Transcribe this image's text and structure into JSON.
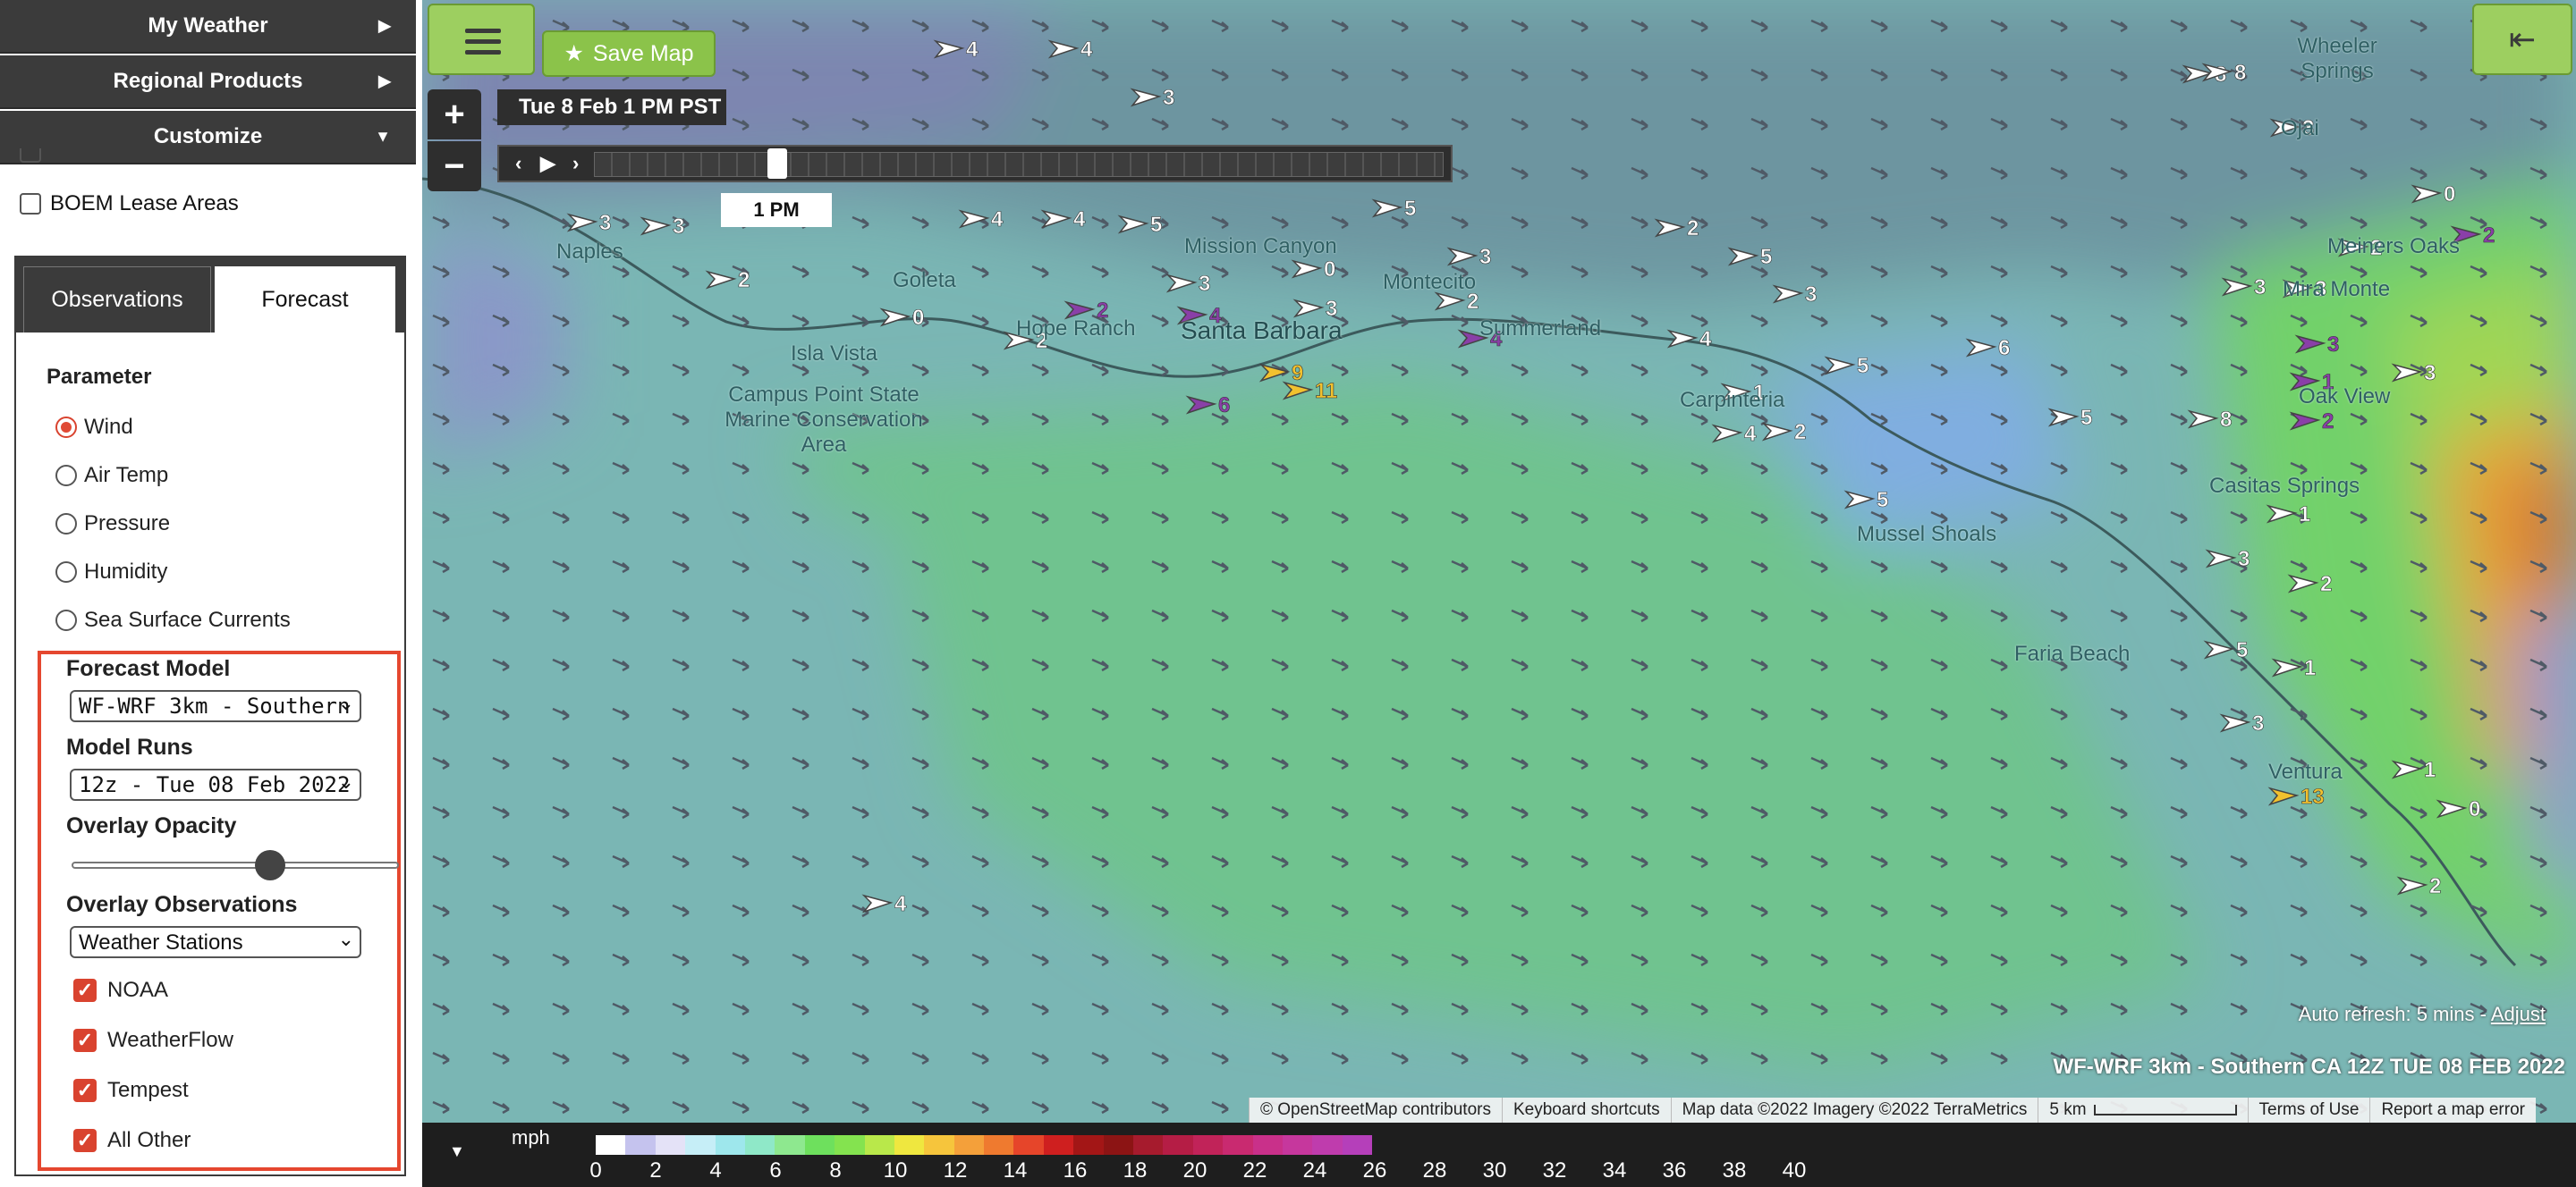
{
  "sidebar": {
    "headers": {
      "my_weather": "My Weather",
      "regional_products": "Regional Products",
      "customize": "Customize"
    },
    "layers": {
      "boem_lease_areas": "BOEM Lease Areas"
    },
    "tabs": {
      "observations": "Observations",
      "forecast": "Forecast"
    },
    "parameter": {
      "title": "Parameter",
      "options": [
        "Wind",
        "Air Temp",
        "Pressure",
        "Humidity",
        "Sea Surface Currents"
      ],
      "selected": "Wind"
    },
    "forecast_model": {
      "label": "Forecast Model",
      "value": "WF-WRF 3km - Southern CA"
    },
    "model_runs": {
      "label": "Model Runs",
      "value": "12z - Tue 08 Feb 2022"
    },
    "overlay_opacity": {
      "label": "Overlay Opacity",
      "value": 0.6
    },
    "overlay_observations": {
      "label": "Overlay Observations",
      "value": "Weather Stations",
      "checks": [
        "NOAA",
        "WeatherFlow",
        "Tempest",
        "All Other"
      ]
    }
  },
  "map": {
    "save_map_label": "Save Map",
    "zoom_in": "+",
    "zoom_out": "−",
    "time_label": "Tue 8 Feb 1 PM PST",
    "time_popup": "1 PM",
    "timeline_controls": {
      "prev": "‹",
      "play": "▶",
      "next": "›"
    },
    "title": "WF-WRF 3km - Southern CA 12Z TUE 08 FEB 2022",
    "auto_refresh": "Auto refresh: 5 mins - ",
    "auto_refresh_link": "Adjust",
    "attribution": {
      "osm": "© OpenStreetMap contributors",
      "shortcuts": "Keyboard shortcuts",
      "map_data": "Map data ©2022 Imagery ©2022 TerraMetrics",
      "scale": "5 km",
      "terms": "Terms of Use",
      "report": "Report a map error"
    },
    "places": {
      "naples": "Naples",
      "goleta": "Goleta",
      "isla_vista": "Isla Vista",
      "hope_ranch": "Hope Ranch",
      "santa_barbara": "Santa Barbara",
      "mission_canyon": "Mission Canyon",
      "montecito": "Montecito",
      "summerland": "Summerland",
      "carpinteria": "Carpinteria",
      "mussel_shoals": "Mussel Shoals",
      "faria_beach": "Faria Beach",
      "ventura": "Ventura",
      "casitas_springs": "Casitas Springs",
      "oak_view": "Oak View",
      "mira_monte": "Mira Monte",
      "meiners_oaks": "Meiners Oaks",
      "ojai": "Ojai",
      "wheeler_springs": "Wheeler Springs",
      "campus_point": "Campus Point State Marine Conservation Area"
    },
    "stations": [
      {
        "v": "4",
        "c": "#ffffff"
      },
      {
        "v": "4",
        "c": "#ffffff"
      },
      {
        "v": "3",
        "c": "#ffffff"
      },
      {
        "v": "3",
        "c": "#ffffff"
      },
      {
        "v": "3",
        "c": "#ffffff"
      },
      {
        "v": "4",
        "c": "#ffffff"
      },
      {
        "v": "4",
        "c": "#ffffff"
      },
      {
        "v": "5",
        "c": "#ffffff"
      },
      {
        "v": "5",
        "c": "#ffffff"
      },
      {
        "v": "2",
        "c": "#ffffff"
      },
      {
        "v": "0",
        "c": "#ffffff"
      },
      {
        "v": "2",
        "c": "#ffffff"
      },
      {
        "v": "2",
        "c": "#8a3fa8"
      },
      {
        "v": "4",
        "c": "#8a3fa8"
      },
      {
        "v": "3",
        "c": "#ffffff"
      },
      {
        "v": "3",
        "c": "#ffffff"
      },
      {
        "v": "0",
        "c": "#ffffff"
      },
      {
        "v": "3",
        "c": "#ffffff"
      },
      {
        "v": "2",
        "c": "#ffffff"
      },
      {
        "v": "4",
        "c": "#8a3fa8"
      },
      {
        "v": "2",
        "c": "#ffffff"
      },
      {
        "v": "5",
        "c": "#ffffff"
      },
      {
        "v": "3",
        "c": "#ffffff"
      },
      {
        "v": "6",
        "c": "#8a3fa8"
      },
      {
        "v": "9",
        "c": "#f2c12e"
      },
      {
        "v": "11",
        "c": "#f2c12e"
      },
      {
        "v": "4",
        "c": "#ffffff"
      },
      {
        "v": "1",
        "c": "#ffffff"
      },
      {
        "v": "2",
        "c": "#ffffff"
      },
      {
        "v": "4",
        "c": "#ffffff"
      },
      {
        "v": "5",
        "c": "#ffffff"
      },
      {
        "v": "6",
        "c": "#ffffff"
      },
      {
        "v": "5",
        "c": "#ffffff"
      },
      {
        "v": "5",
        "c": "#ffffff"
      },
      {
        "v": "8",
        "c": "#ffffff"
      },
      {
        "v": "8",
        "c": "#ffffff"
      },
      {
        "v": "3",
        "c": "#ffffff"
      },
      {
        "v": "0",
        "c": "#ffffff"
      },
      {
        "v": "2",
        "c": "#8a3fa8"
      },
      {
        "v": "2",
        "c": "#ffffff"
      },
      {
        "v": "3",
        "c": "#ffffff"
      },
      {
        "v": "3",
        "c": "#ffffff"
      },
      {
        "v": "3",
        "c": "#8a3fa8"
      },
      {
        "v": "1",
        "c": "#8a3fa8"
      },
      {
        "v": "2",
        "c": "#8a3fa8"
      },
      {
        "v": "3",
        "c": "#ffffff"
      },
      {
        "v": "1",
        "c": "#ffffff"
      },
      {
        "v": "3",
        "c": "#ffffff"
      },
      {
        "v": "2",
        "c": "#ffffff"
      },
      {
        "v": "5",
        "c": "#ffffff"
      },
      {
        "v": "1",
        "c": "#ffffff"
      },
      {
        "v": "3",
        "c": "#ffffff"
      },
      {
        "v": "1",
        "c": "#ffffff"
      },
      {
        "v": "13",
        "c": "#f2c12e"
      },
      {
        "v": "0",
        "c": "#ffffff"
      },
      {
        "v": "2",
        "c": "#ffffff"
      },
      {
        "v": "4",
        "c": "#ffffff"
      },
      {
        "v": "8",
        "c": "#ffffff"
      }
    ]
  },
  "legend": {
    "unit": "mph",
    "ticks": [
      "0",
      "2",
      "4",
      "6",
      "8",
      "10",
      "12",
      "14",
      "16",
      "18",
      "20",
      "22",
      "24",
      "26",
      "28",
      "30",
      "32",
      "34",
      "36",
      "38",
      "40"
    ],
    "colors": [
      "#ffffff",
      "#c5c3ee",
      "#e4e2f7",
      "#c6eef7",
      "#9ee7ec",
      "#8fe8c8",
      "#8ee88f",
      "#6ee05d",
      "#84e34f",
      "#b9e84a",
      "#efe73f",
      "#f6c53c",
      "#f4a03a",
      "#ef7a2f",
      "#e6452a",
      "#cf1f1f",
      "#a31616",
      "#8c1414",
      "#a61b2d",
      "#b51d45",
      "#c12359",
      "#c92a70",
      "#c9308a",
      "#c6379d",
      "#bf3cad",
      "#b53fba"
    ]
  },
  "colors": {
    "accent": "#e5472f",
    "header_bg": "#3b3b3b",
    "save_button": "#8bc34a"
  }
}
